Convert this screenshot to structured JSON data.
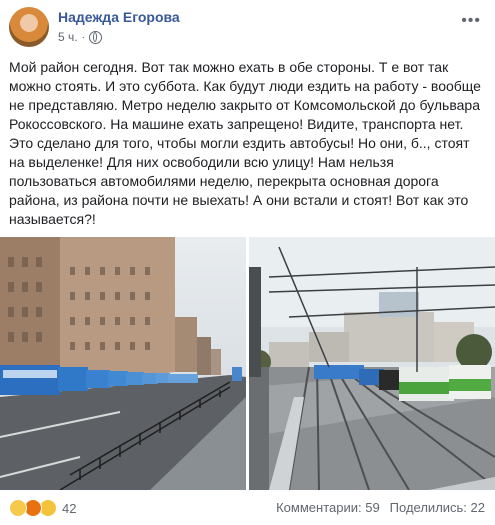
{
  "post": {
    "author": "Надежда Егорова",
    "time": "5 ч.",
    "lines": [
      "Мой район сегодня. Вот так можно ехать в обе стороны. Т е вот так",
      "можно стоять. И это суббота. Как будут люди ездить на работу - вообще",
      "не представляю. Метро неделю закрыто от Комсомольской до бульвара",
      "Рокоссовского. На машине ехать запрещено! Видите, транспорта нет.",
      "Это сделано для того, чтобы могли ездить автобусы! Но они, б.., стоят",
      "на выделенке! Для них освободили всю улицу! Нам нельзя",
      "пользоваться автомобилями неделю, перекрыта основная дорога",
      "района, из района почти не выехать! А они встали и стоят! Вот как это",
      "называется?!"
    ]
  },
  "footer": {
    "reaction_count": "42",
    "comments": "Комментарии: 59",
    "shares": "Поделились: 22"
  },
  "icons": {
    "more": "more-dots-icon",
    "privacy": "globe-icon",
    "reactions": [
      "wow-icon",
      "angry-icon",
      "sad-icon"
    ]
  }
}
